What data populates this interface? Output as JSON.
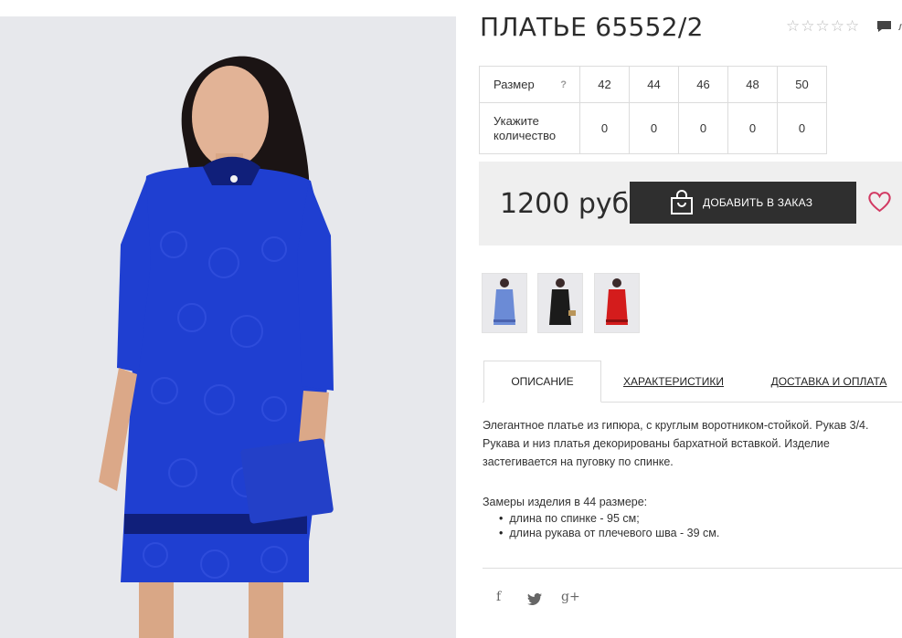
{
  "product": {
    "title": "ПЛАТЬЕ 65552/2",
    "stars": "☆☆☆☆☆",
    "comment_text": "л",
    "image_icon": "dress-photo",
    "sizes_header": "Размер",
    "size_hint": "?",
    "qty_label": "Укажите количество",
    "sizes": [
      "42",
      "44",
      "46",
      "48",
      "50"
    ],
    "quantities": [
      "0",
      "0",
      "0",
      "0",
      "0"
    ],
    "price": "1200 руб",
    "add_to_cart": "ДОБАВИТЬ В ЗАКАЗ",
    "colors": {
      "dress_blue": "#1f3fd1",
      "dress_black": "#1b1b1b",
      "dress_red": "#d41c1c",
      "button": "#2f2f2f",
      "heart": "#d23a63"
    }
  },
  "thumbnails": [
    {
      "name": "thumb-blue",
      "color": "#6b8bd6"
    },
    {
      "name": "thumb-black",
      "color": "#1b1b1b"
    },
    {
      "name": "thumb-red",
      "color": "#d41c1c"
    }
  ],
  "tabs": {
    "description": "ОПИСАНИЕ",
    "characteristics": "ХАРАКТЕРИСТИКИ",
    "delivery": "ДОСТАВКА И ОПЛАТА"
  },
  "description": {
    "text": "Элегантное платье из гипюра, с круглым воротником-стойкой. Рукав 3/4. Рукава и низ платья декорированы бархатной вставкой. Изделие застегивается на пуговку по спинке.",
    "measure_title": "Замеры изделия в 44 размере:",
    "measures": [
      "длина по спинке - 95 см;",
      "длина рукава от плечевого шва - 39 см."
    ]
  },
  "social": {
    "facebook": "f",
    "twitter": "twitter-icon",
    "googleplus": "g+"
  }
}
